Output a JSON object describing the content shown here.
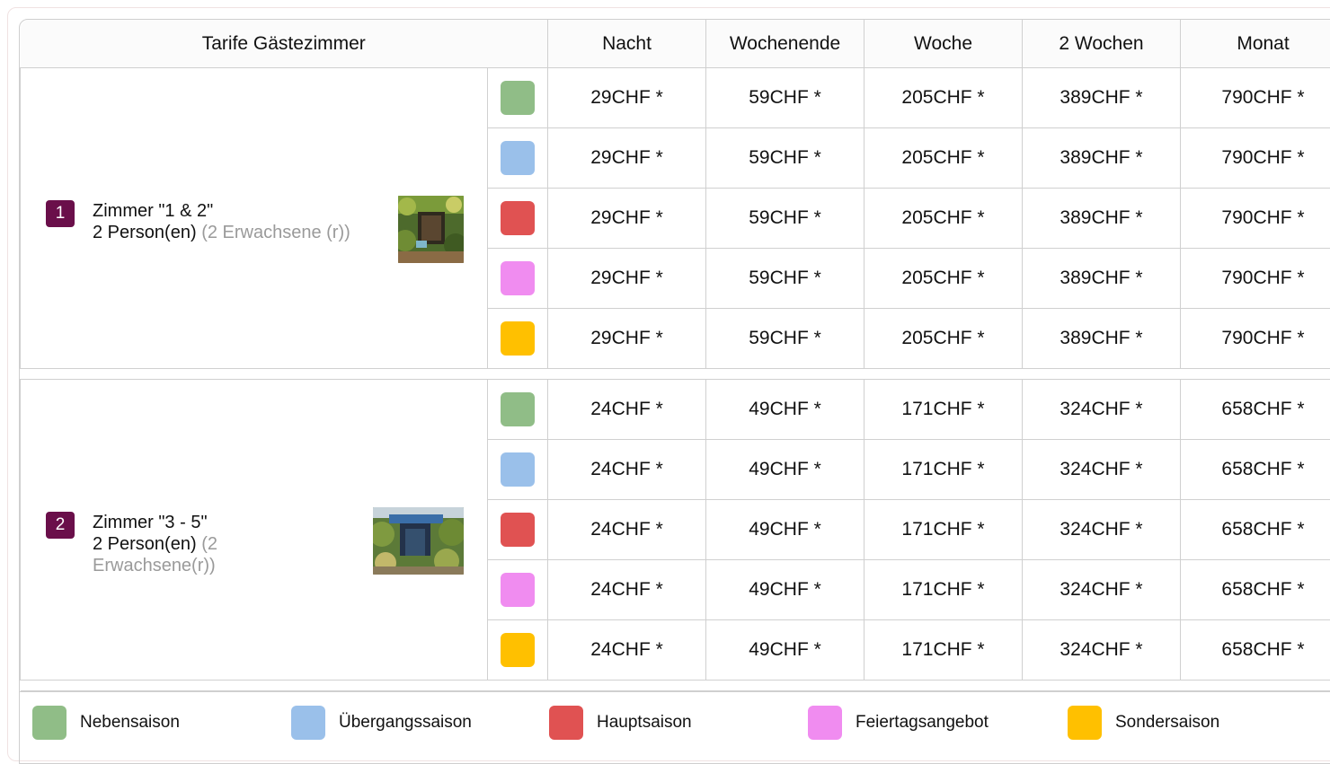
{
  "table": {
    "headers": [
      "Tarife Gästezimmer",
      "Nacht",
      "Wochenende",
      "Woche",
      "2 Wochen",
      "Monat"
    ]
  },
  "seasons": [
    {
      "name": "Nebensaison",
      "color": "#90bd87"
    },
    {
      "name": "Übergangssaison",
      "color": "#9ac0ea"
    },
    {
      "name": "Hauptsaison",
      "color": "#e05252"
    },
    {
      "name": "Feiertagsangebot",
      "color": "#f08cf0"
    },
    {
      "name": "Sondersaison",
      "color": "#ffc000"
    }
  ],
  "rooms": [
    {
      "number": "1",
      "name": "Zimmer \"1 & 2\"",
      "persons": "2 Person(en)",
      "detail": "(2 Erwachsene (r))",
      "rates": [
        [
          "29CHF *",
          "59CHF *",
          "205CHF *",
          "389CHF *",
          "790CHF *"
        ],
        [
          "29CHF *",
          "59CHF *",
          "205CHF *",
          "389CHF *",
          "790CHF *"
        ],
        [
          "29CHF *",
          "59CHF *",
          "205CHF *",
          "389CHF *",
          "790CHF *"
        ],
        [
          "29CHF *",
          "59CHF *",
          "205CHF *",
          "389CHF *",
          "790CHF *"
        ],
        [
          "29CHF *",
          "59CHF *",
          "205CHF *",
          "389CHF *",
          "790CHF *"
        ]
      ]
    },
    {
      "number": "2",
      "name": "Zimmer \"3 - 5\"",
      "persons": "2 Person(en)",
      "detail": "(2 Erwachsene(r))",
      "rates": [
        [
          "24CHF *",
          "49CHF *",
          "171CHF *",
          "324CHF *",
          "658CHF *"
        ],
        [
          "24CHF *",
          "49CHF *",
          "171CHF *",
          "324CHF *",
          "658CHF *"
        ],
        [
          "24CHF *",
          "49CHF *",
          "171CHF *",
          "324CHF *",
          "658CHF *"
        ],
        [
          "24CHF *",
          "49CHF *",
          "171CHF *",
          "324CHF *",
          "658CHF *"
        ],
        [
          "24CHF *",
          "49CHF *",
          "171CHF *",
          "324CHF *",
          "658CHF *"
        ]
      ]
    }
  ]
}
